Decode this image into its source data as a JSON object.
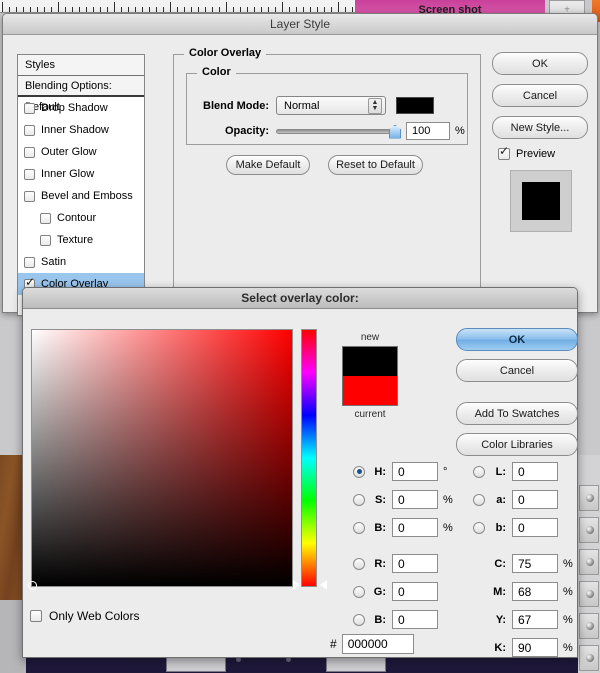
{
  "background": {
    "top_image_caption": "Screen shot",
    "top_button_icon": "plus-icon"
  },
  "layer_style": {
    "title": "Layer Style",
    "styles_header": "Styles",
    "blending_header": "Blending Options: Default",
    "effects": [
      {
        "label": "Drop Shadow",
        "checked": false,
        "indent": false,
        "selected": false
      },
      {
        "label": "Inner Shadow",
        "checked": false,
        "indent": false,
        "selected": false
      },
      {
        "label": "Outer Glow",
        "checked": false,
        "indent": false,
        "selected": false
      },
      {
        "label": "Inner Glow",
        "checked": false,
        "indent": false,
        "selected": false
      },
      {
        "label": "Bevel and Emboss",
        "checked": false,
        "indent": false,
        "selected": false
      },
      {
        "label": "Contour",
        "checked": false,
        "indent": true,
        "selected": false
      },
      {
        "label": "Texture",
        "checked": false,
        "indent": true,
        "selected": false
      },
      {
        "label": "Satin",
        "checked": false,
        "indent": false,
        "selected": false
      },
      {
        "label": "Color Overlay",
        "checked": true,
        "indent": false,
        "selected": true
      }
    ],
    "overlay_group_title": "Color Overlay",
    "color_group_title": "Color",
    "blend_mode_label": "Blend Mode:",
    "blend_mode_value": "Normal",
    "overlay_color_hex": "#000000",
    "opacity_label": "Opacity:",
    "opacity_value": "100",
    "opacity_unit": "%",
    "make_default_label": "Make Default",
    "reset_default_label": "Reset to Default",
    "ok_label": "OK",
    "cancel_label": "Cancel",
    "new_style_label": "New Style...",
    "preview_label": "Preview",
    "preview_checked": true,
    "preview_swatch_hex": "#000000"
  },
  "color_picker": {
    "title": "Select overlay color:",
    "ok_label": "OK",
    "cancel_label": "Cancel",
    "add_to_swatches_label": "Add To Swatches",
    "color_libraries_label": "Color Libraries",
    "new_label": "new",
    "current_label": "current",
    "new_color_hex": "#000000",
    "current_color_hex": "#ff0000",
    "only_web_colors_label": "Only Web Colors",
    "only_web_colors_checked": false,
    "hex_prefix": "#",
    "hex_value": "000000",
    "hsb": [
      {
        "key": "H",
        "label": "H:",
        "value": "0",
        "unit": "°",
        "selected": true
      },
      {
        "key": "S",
        "label": "S:",
        "value": "0",
        "unit": "%",
        "selected": false
      },
      {
        "key": "B",
        "label": "B:",
        "value": "0",
        "unit": "%",
        "selected": false
      }
    ],
    "rgb": [
      {
        "key": "R",
        "label": "R:",
        "value": "0",
        "unit": "",
        "selected": false
      },
      {
        "key": "G",
        "label": "G:",
        "value": "0",
        "unit": "",
        "selected": false
      },
      {
        "key": "B",
        "label": "B:",
        "value": "0",
        "unit": "",
        "selected": false
      }
    ],
    "lab": [
      {
        "key": "L",
        "label": "L:",
        "value": "0",
        "unit": "",
        "selected": false
      },
      {
        "key": "a",
        "label": "a:",
        "value": "0",
        "unit": "",
        "selected": false
      },
      {
        "key": "b",
        "label": "b:",
        "value": "0",
        "unit": "",
        "selected": false
      }
    ],
    "cmyk": [
      {
        "key": "C",
        "label": "C:",
        "value": "75",
        "unit": "%"
      },
      {
        "key": "M",
        "label": "M:",
        "value": "68",
        "unit": "%"
      },
      {
        "key": "Y",
        "label": "Y:",
        "value": "67",
        "unit": "%"
      },
      {
        "key": "K",
        "label": "K:",
        "value": "90",
        "unit": "%"
      }
    ]
  }
}
